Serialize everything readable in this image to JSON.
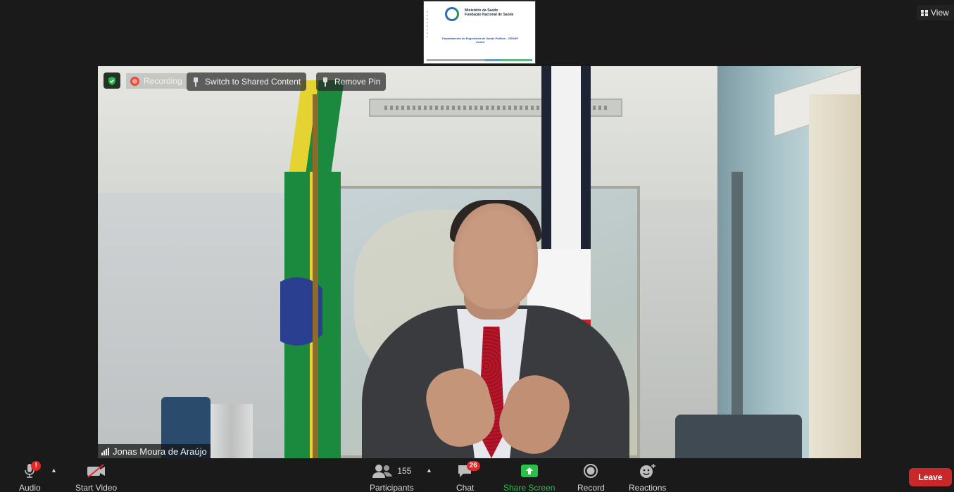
{
  "header": {
    "view_label": "View",
    "view_icon": "grid-icon"
  },
  "shared_thumb": {
    "org_line1": "Ministério da Saúde",
    "org_line2": "Fundação Nacional de Saúde",
    "dept": "Departamento de Engenharia de Saúde Pública – DENSP",
    "sub": "Coord"
  },
  "video": {
    "recording_label": "Recording",
    "switch_label": "Switch to Shared Content",
    "remove_pin_label": "Remove Pin",
    "participant_name": "Jonas Moura de Araújo"
  },
  "toolbar": {
    "audio_label": "Audio",
    "audio_badge": "!",
    "start_video_label": "Start Video",
    "participants_label": "Participants",
    "participants_count": "155",
    "chat_label": "Chat",
    "chat_badge": "26",
    "share_label": "Share Screen",
    "record_label": "Record",
    "reactions_label": "Reactions",
    "leave_label": "Leave"
  },
  "colors": {
    "leave": "#c9282a",
    "share": "#29c04a",
    "badge": "#e02828"
  }
}
